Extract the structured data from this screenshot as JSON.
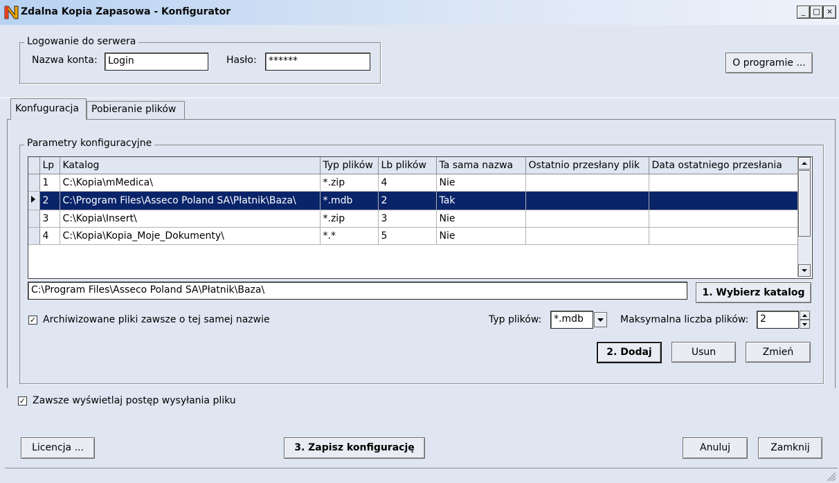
{
  "window": {
    "title": "Zdalna Kopia Zapasowa - Konfigurator",
    "btn_min": "_",
    "btn_max": "□",
    "btn_close": "×"
  },
  "login": {
    "group_label": "Logowanie do serwera",
    "account_label": "Nazwa konta:",
    "account_value": "Login",
    "password_label": "Hasło:",
    "password_value": "******"
  },
  "about_button": "O programie ...",
  "tabs": [
    {
      "label": "Konfuguracja",
      "active": true
    },
    {
      "label": "Pobieranie plików",
      "active": false
    }
  ],
  "config": {
    "group_label": "Parametry konfiguracyjne",
    "columns": [
      "Lp",
      "Katalog",
      "Typ plików",
      "Lb plików",
      "Ta sama nazwa",
      "Ostatnio przesłany plik",
      "Data ostatniego przesłania"
    ],
    "rows": [
      {
        "lp": "1",
        "katalog": "C:\\Kopia\\mMedica\\",
        "typ": "*.zip",
        "lb": "4",
        "nazwa": "Nie",
        "ostatni": "",
        "data": ""
      },
      {
        "lp": "2",
        "katalog": "C:\\Program Files\\Asseco Poland SA\\Płatnik\\Baza\\",
        "typ": "*.mdb",
        "lb": "2",
        "nazwa": "Tak",
        "ostatni": "",
        "data": ""
      },
      {
        "lp": "3",
        "katalog": "C:\\Kopia\\Insert\\",
        "typ": "*.zip",
        "lb": "3",
        "nazwa": "Nie",
        "ostatni": "",
        "data": ""
      },
      {
        "lp": "4",
        "katalog": "C:\\Kopia\\Kopia_Moje_Dokumenty\\",
        "typ": "*.*",
        "lb": "5",
        "nazwa": "Nie",
        "ostatni": "",
        "data": ""
      }
    ],
    "selected_row": 1,
    "path_value": "C:\\Program Files\\Asseco Poland SA\\Płatnik\\Baza\\",
    "choose_dir_button": "1. Wybierz katalog",
    "same_name_checkbox": "Archiwizowane pliki zawsze o tej samej nazwie",
    "same_name_checked": true,
    "filetype_label": "Typ plików:",
    "filetype_value": "*.mdb",
    "max_files_label": "Maksymalna liczba plików:",
    "max_files_value": "2",
    "add_button": "2. Dodaj",
    "remove_button": "Usun",
    "change_button": "Zmień"
  },
  "progress_checkbox": "Zawsze wyświetlaj postęp wysyłania pliku",
  "progress_checked": true,
  "footer": {
    "license_button": "Licencja ...",
    "save_button": "3. Zapisz konfigurację",
    "cancel_button": "Anuluj",
    "close_button": "Zamknij"
  },
  "colors": {
    "selection": "#0a246a",
    "face": "#dfe6f2"
  }
}
